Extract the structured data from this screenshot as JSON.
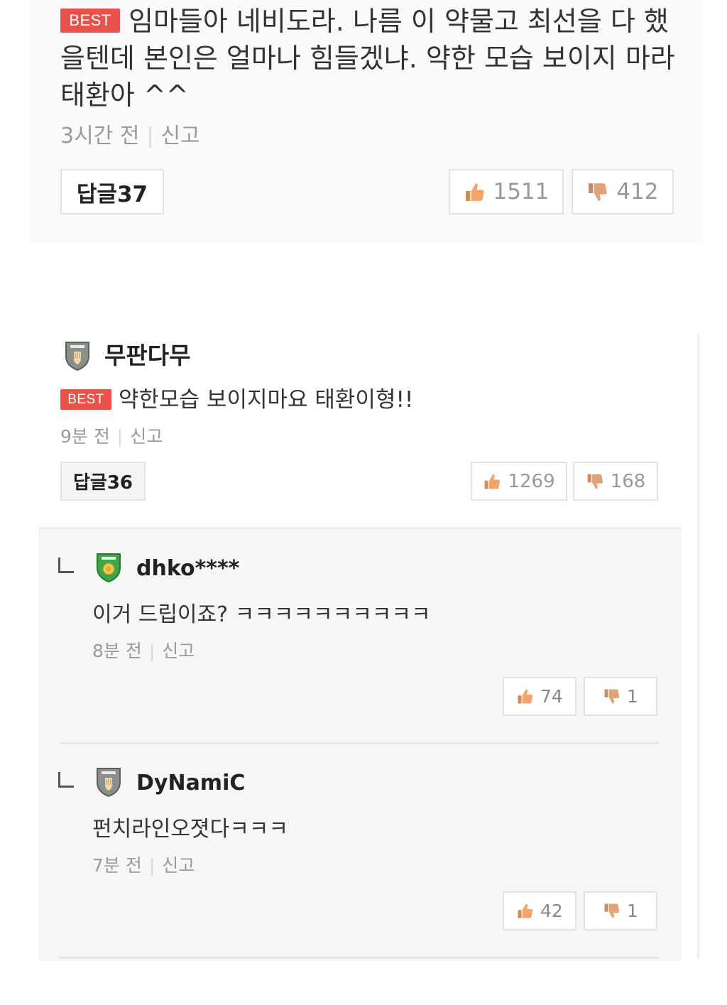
{
  "colors": {
    "best_badge": "#e8524a",
    "thumb_up": "#f4a46b",
    "thumb_down": "#e0a27a",
    "badge_gray": "#8a8f8a",
    "badge_green": "#3aa84a",
    "meta_text": "#9a9a9a"
  },
  "comment1": {
    "badge": "BEST",
    "text": "임마들아 네비도라. 나름 이 약물고 최선을 다 했을텐데 본인은 얼마나 힘들겠냐. 약한 모습 보이지 마라 태환아 ^^",
    "time": "3시간 전",
    "report": "신고",
    "reply_label": "답글37",
    "likes": "1511",
    "dislikes": "412",
    "like_icon": "thumbs-up-icon",
    "dislike_icon": "thumbs-down-icon"
  },
  "comment2": {
    "user": "무판다무",
    "user_icon": "gray-shield-badge-icon",
    "badge": "BEST",
    "text": "약한모습 보이지마요 태환이형!!",
    "time": "9분 전",
    "report": "신고",
    "reply_label": "답글36",
    "likes": "1269",
    "dislikes": "168",
    "replies": [
      {
        "user": "dhko****",
        "user_icon": "green-shield-badge-icon",
        "text": "이거 드립이죠? ㅋㅋㅋㅋㅋㅋㅋㅋㅋㅋ",
        "time": "8분 전",
        "report": "신고",
        "likes": "74",
        "dislikes": "1"
      },
      {
        "user": "DyNamiC",
        "user_icon": "gray-shield-badge-icon",
        "text": "펀치라인오졋다ㅋㅋㅋ",
        "time": "7분 전",
        "report": "신고",
        "likes": "42",
        "dislikes": "1"
      }
    ]
  }
}
